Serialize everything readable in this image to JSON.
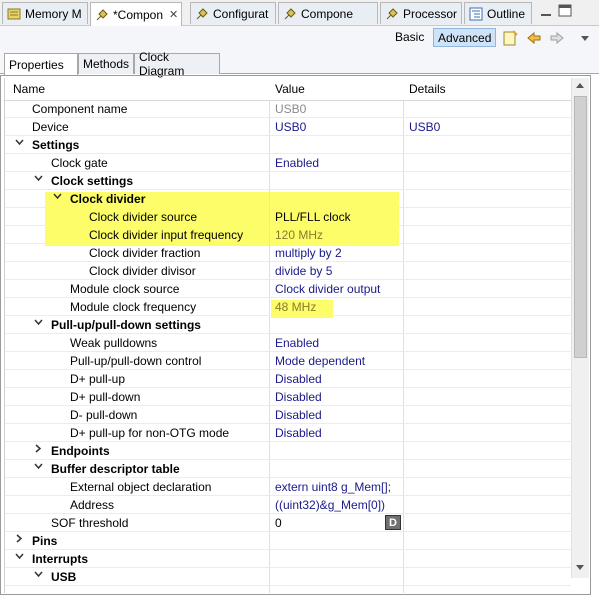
{
  "tabs": [
    {
      "label": "Memory M"
    },
    {
      "label": "*Compon",
      "close": "✕"
    },
    {
      "label": "Configurat"
    },
    {
      "label": "Compone"
    },
    {
      "label": "Processor"
    },
    {
      "label": "Outline"
    }
  ],
  "toolbar": {
    "basic": "Basic",
    "advanced": "Advanced"
  },
  "subtabs": [
    "Properties",
    "Methods",
    "Clock Diagram"
  ],
  "table": {
    "headers": {
      "name": "Name",
      "value": "Value",
      "details": "Details"
    },
    "rows": [
      {
        "name": "Component name",
        "value": "USB0",
        "details": ""
      },
      {
        "name": "Device",
        "value": "USB0",
        "details": "USB0"
      },
      {
        "name": "Settings",
        "value": "",
        "details": ""
      },
      {
        "name": "Clock gate",
        "value": "Enabled",
        "details": ""
      },
      {
        "name": "Clock settings",
        "value": "",
        "details": ""
      },
      {
        "name": "Clock divider",
        "value": "",
        "details": ""
      },
      {
        "name": "Clock divider source",
        "value": "PLL/FLL clock",
        "details": ""
      },
      {
        "name": "Clock divider input frequency",
        "value": "120 MHz",
        "details": ""
      },
      {
        "name": "Clock divider fraction",
        "value": "multiply by 2",
        "details": ""
      },
      {
        "name": "Clock divider divisor",
        "value": "divide by 5",
        "details": ""
      },
      {
        "name": "Module clock source",
        "value": "Clock divider output",
        "details": ""
      },
      {
        "name": "Module clock frequency",
        "value": "48 MHz",
        "details": ""
      },
      {
        "name": "Pull-up/pull-down settings",
        "value": "",
        "details": ""
      },
      {
        "name": "Weak pulldowns",
        "value": "Enabled",
        "details": ""
      },
      {
        "name": "Pull-up/pull-down control",
        "value": "Mode dependent",
        "details": ""
      },
      {
        "name": "D+ pull-up",
        "value": "Disabled",
        "details": ""
      },
      {
        "name": "D+ pull-down",
        "value": "Disabled",
        "details": ""
      },
      {
        "name": "D- pull-down",
        "value": "Disabled",
        "details": ""
      },
      {
        "name": "D+ pull-up for non-OTG mode",
        "value": "Disabled",
        "details": ""
      },
      {
        "name": "Endpoints",
        "value": "",
        "details": ""
      },
      {
        "name": "Buffer descriptor table",
        "value": "",
        "details": ""
      },
      {
        "name": "External object declaration",
        "value": "extern uint8 g_Mem[];",
        "details": ""
      },
      {
        "name": "Address",
        "value": "((uint32)&g_Mem[0])",
        "details": ""
      },
      {
        "name": "SOF threshold",
        "value": "0",
        "details": "",
        "button": "D"
      },
      {
        "name": "Pins",
        "value": "",
        "details": ""
      },
      {
        "name": "Interrupts",
        "value": "",
        "details": ""
      },
      {
        "name": "USB",
        "value": "",
        "details": ""
      }
    ]
  },
  "colors": {
    "highlight": "#fdfd6a",
    "value_text": "#1a1a8a",
    "advanced_bg": "#cfe3f7"
  },
  "icons": [
    "component-tab-icon",
    "outline-tab-icon",
    "new-document-icon",
    "back-arrow-icon",
    "forward-arrow-icon",
    "view-menu-icon"
  ]
}
